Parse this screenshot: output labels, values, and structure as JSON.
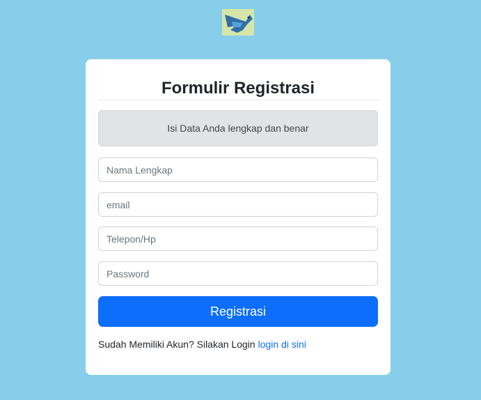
{
  "logo": {
    "icon": "bird-logo-icon"
  },
  "form": {
    "title": "Formulir Registrasi",
    "notice": "Isi Data Anda lengkap dan benar",
    "fields": {
      "name_placeholder": "Nama Lengkap",
      "email_placeholder": "email",
      "phone_placeholder": "Telepon/Hp",
      "password_placeholder": "Password"
    },
    "submit_label": "Registrasi",
    "login_prompt": "Sudah Memiliki Akun? Silakan Login",
    "login_link": "login di sini"
  },
  "colors": {
    "background": "#87ceeb",
    "primary": "#0d6efd",
    "notice_bg": "#e2e3e5"
  }
}
